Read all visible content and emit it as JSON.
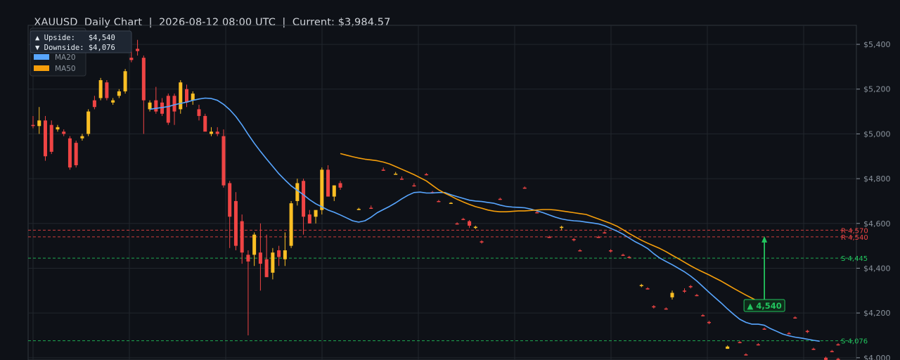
{
  "header": {
    "symbol": "XAUUSD",
    "chart_label": "Daily Chart",
    "timestamp": "2026-08-12 08:00 UTC",
    "current": "Current: $3,984.57"
  },
  "targets_box": {
    "upside": "▲ Upside:   $4,540",
    "downside": "▼ Downside: $4,076"
  },
  "legend": [
    {
      "label": "MA20",
      "color": "#58a6ff"
    },
    {
      "label": "MA50",
      "color": "#f59e0b"
    }
  ],
  "colors": {
    "background": "#0e1117",
    "grid": "#21262d",
    "up": "#fbbf24",
    "down": "#ef4444",
    "support": "#22c55e",
    "resistance": "#ef4444"
  },
  "levels": [
    {
      "label": "R 4,570",
      "value": 4570,
      "kind": "resistance"
    },
    {
      "label": "R 4,540",
      "value": 4540,
      "kind": "resistance"
    },
    {
      "label": "S 4,445",
      "value": 4445,
      "kind": "support"
    },
    {
      "label": "S 4,076",
      "value": 4076,
      "kind": "support"
    }
  ],
  "target_marker": {
    "label": "▲ 4,540",
    "value": 4540,
    "from": 4235,
    "bar": 119
  },
  "chart_data": {
    "type": "candlestick",
    "title": "XAUUSD  Daily Chart",
    "y_ticks": [
      {
        "value": 4000,
        "label": "$4,000"
      },
      {
        "value": 4200,
        "label": "$4,200"
      },
      {
        "value": 4400,
        "label": "$4,400"
      },
      {
        "value": 4600,
        "label": "$4,600"
      },
      {
        "value": 4800,
        "label": "$4,800"
      },
      {
        "value": 5000,
        "label": "$5,000"
      },
      {
        "value": 5200,
        "label": "$5,200"
      },
      {
        "value": 5400,
        "label": "$5,400"
      }
    ],
    "ylim": [
      3990,
      5485
    ],
    "x_count": 132,
    "candles": [
      [
        5040,
        5080,
        5025,
        5035
      ],
      [
        5035,
        5120,
        5000,
        5060
      ],
      [
        5060,
        5080,
        4880,
        4900
      ],
      [
        5040,
        5060,
        4910,
        4920
      ],
      [
        5020,
        5040,
        5010,
        5030
      ],
      [
        5010,
        5020,
        4990,
        5000
      ],
      [
        4980,
        4990,
        4840,
        4850
      ],
      [
        4960,
        4970,
        4850,
        4860
      ],
      [
        4980,
        5000,
        4970,
        4990
      ],
      [
        5000,
        5110,
        4990,
        5100
      ],
      [
        5150,
        5170,
        5110,
        5120
      ],
      [
        5160,
        5250,
        5150,
        5240
      ],
      [
        5230,
        5240,
        5150,
        5160
      ],
      [
        5140,
        5160,
        5130,
        5150
      ],
      [
        5170,
        5200,
        5160,
        5190
      ],
      [
        5190,
        5290,
        5180,
        5280
      ],
      [
        5340,
        5370,
        5320,
        5330
      ],
      [
        5380,
        5420,
        5350,
        5370
      ],
      [
        5340,
        5350,
        5000,
        5150
      ],
      [
        5110,
        5150,
        5100,
        5140
      ],
      [
        5150,
        5210,
        5090,
        5100
      ],
      [
        5140,
        5160,
        5080,
        5090
      ],
      [
        5170,
        5180,
        5040,
        5050
      ],
      [
        5170,
        5180,
        5040,
        5100
      ],
      [
        5110,
        5240,
        5090,
        5230
      ],
      [
        5200,
        5220,
        5120,
        5140
      ],
      [
        5150,
        5190,
        5130,
        5180
      ],
      [
        5110,
        5130,
        5060,
        5080
      ],
      [
        5080,
        5090,
        5020,
        5010
      ],
      [
        5000,
        5030,
        4990,
        5010
      ],
      [
        5010,
        5030,
        4990,
        5000
      ],
      [
        4990,
        5020,
        4760,
        4770
      ],
      [
        4780,
        4790,
        4490,
        4630
      ],
      [
        4700,
        4740,
        4480,
        4500
      ],
      [
        4610,
        4640,
        4420,
        4470
      ],
      [
        4460,
        4480,
        4100,
        4430
      ],
      [
        4460,
        4560,
        4410,
        4550
      ],
      [
        4470,
        4600,
        4300,
        4420
      ],
      [
        4440,
        4550,
        4370,
        4360
      ],
      [
        4380,
        4490,
        4350,
        4470
      ],
      [
        4480,
        4500,
        4410,
        4450
      ],
      [
        4440,
        4560,
        4410,
        4480
      ],
      [
        4500,
        4700,
        4490,
        4690
      ],
      [
        4700,
        4800,
        4680,
        4780
      ],
      [
        4790,
        4800,
        4550,
        4630
      ],
      [
        4640,
        4660,
        4600,
        4600
      ],
      [
        4630,
        4640,
        4600,
        4660
      ],
      [
        4660,
        4850,
        4640,
        4840
      ],
      [
        4840,
        4860,
        4720,
        4720
      ],
      [
        4720,
        4770,
        4700,
        4770
      ],
      [
        4780,
        4790,
        4750,
        4760
      ],
      [
        4660,
        4670,
        4660,
        4665
      ],
      [
        4670,
        4680,
        4665,
        4668
      ],
      [
        4840,
        4850,
        4835,
        4838
      ],
      [
        4820,
        4830,
        4818,
        4822
      ],
      [
        4800,
        4810,
        4795,
        4798
      ],
      [
        4770,
        4780,
        4765,
        4768
      ],
      [
        4820,
        4825,
        4815,
        4818
      ],
      [
        4740,
        4745,
        4735,
        4738
      ],
      [
        4700,
        4705,
        4695,
        4698
      ],
      [
        4690,
        4695,
        4688,
        4692
      ],
      [
        4600,
        4605,
        4595,
        4598
      ],
      [
        4620,
        4625,
        4615,
        4618
      ],
      [
        4610,
        4615,
        4580,
        4590
      ],
      [
        4580,
        4590,
        4575,
        4585
      ],
      [
        4520,
        4525,
        4510,
        4515
      ],
      [
        4710,
        4715,
        4705,
        4708
      ],
      [
        4760,
        4765,
        4755,
        4758
      ],
      [
        4650,
        4655,
        4645,
        4648
      ],
      [
        4540,
        4545,
        4535,
        4538
      ],
      [
        4580,
        4590,
        4570,
        4585
      ],
      [
        4530,
        4535,
        4520,
        4525
      ],
      [
        4480,
        4485,
        4475,
        4478
      ],
      [
        4540,
        4545,
        4535,
        4538
      ],
      [
        4560,
        4565,
        4555,
        4558
      ],
      [
        4480,
        4485,
        4470,
        4475
      ],
      [
        4460,
        4465,
        4455,
        4458
      ],
      [
        4450,
        4455,
        4445,
        4448
      ],
      [
        4320,
        4330,
        4315,
        4325
      ],
      [
        4310,
        4315,
        4305,
        4308
      ],
      [
        4230,
        4235,
        4220,
        4225
      ],
      [
        4220,
        4225,
        4215,
        4218
      ],
      [
        4270,
        4300,
        4260,
        4290
      ],
      [
        4300,
        4310,
        4290,
        4298
      ],
      [
        4320,
        4325,
        4310,
        4315
      ],
      [
        4280,
        4285,
        4275,
        4278
      ],
      [
        4190,
        4195,
        4185,
        4188
      ],
      [
        4160,
        4165,
        4150,
        4155
      ],
      [
        4040,
        4055,
        4040,
        4050
      ],
      [
        4070,
        4075,
        4065,
        4068
      ],
      [
        4015,
        4020,
        4010,
        4012
      ],
      [
        4060,
        4065,
        4055,
        4058
      ],
      [
        4130,
        4135,
        4125,
        4128
      ],
      [
        4110,
        4115,
        4105,
        4108
      ],
      [
        4180,
        4185,
        4175,
        4178
      ],
      [
        4120,
        4125,
        4110,
        4115
      ],
      [
        4040,
        4045,
        4035,
        4038
      ],
      [
        3995,
        4000,
        3990,
        3993
      ],
      [
        4030,
        4035,
        4025,
        4028
      ],
      [
        4060,
        4065,
        4055,
        4058
      ],
      [
        4000,
        4005,
        3995,
        3998
      ],
      [
        3995,
        4000,
        3990,
        3992
      ]
    ],
    "candle_bars": [
      0,
      1,
      2,
      3,
      4,
      5,
      6,
      7,
      8,
      9,
      10,
      11,
      12,
      13,
      14,
      15,
      16,
      17,
      18,
      19,
      20,
      21,
      22,
      23,
      24,
      25,
      26,
      27,
      28,
      29,
      30,
      31,
      32,
      33,
      34,
      35,
      36,
      37,
      38,
      39,
      40,
      41,
      42,
      43,
      44,
      45,
      46,
      47,
      48,
      49,
      50,
      53,
      55,
      57,
      59,
      60,
      62,
      64,
      65,
      66,
      68,
      69,
      70,
      71,
      72,
      73,
      76,
      80,
      82,
      84,
      86,
      88,
      89,
      92,
      93,
      94,
      96,
      97,
      99,
      100,
      101,
      103,
      104,
      106,
      107,
      108,
      109,
      110,
      113,
      115,
      116,
      118,
      119,
      123,
      124,
      126,
      127,
      129,
      130,
      131,
      129,
      131
    ],
    "series": [
      {
        "name": "MA20",
        "start_bar": 19,
        "values": [
          5110,
          5114,
          5118,
          5122,
          5130,
          5136,
          5142,
          5150,
          5156,
          5160,
          5158,
          5150,
          5132,
          5108,
          5078,
          5040,
          4998,
          4958,
          4922,
          4888,
          4855,
          4822,
          4794,
          4768,
          4748,
          4728,
          4706,
          4688,
          4674,
          4660,
          4650,
          4638,
          4625,
          4612,
          4606,
          4612,
          4628,
          4648,
          4662,
          4676,
          4692,
          4710,
          4726,
          4738,
          4740,
          4736,
          4736,
          4738,
          4738,
          4728,
          4720,
          4712,
          4704,
          4700,
          4698,
          4694,
          4690,
          4682,
          4676,
          4673,
          4672,
          4670,
          4664,
          4656,
          4648,
          4638,
          4628,
          4620,
          4615,
          4612,
          4610,
          4606,
          4602,
          4598,
          4590,
          4578,
          4566,
          4552,
          4535,
          4518,
          4504,
          4488,
          4465,
          4445,
          4430,
          4416,
          4400,
          4384,
          4365,
          4343,
          4318,
          4292,
          4268,
          4244,
          4218,
          4194,
          4172,
          4158,
          4150,
          4150,
          4145,
          4130,
          4118,
          4106,
          4098,
          4092,
          4088,
          4083,
          4078,
          4074
        ]
      },
      {
        "name": "MA50",
        "start_bar": 50,
        "values": [
          4912,
          4905,
          4898,
          4892,
          4887,
          4884,
          4880,
          4874,
          4866,
          4854,
          4842,
          4830,
          4818,
          4804,
          4790,
          4770,
          4750,
          4735,
          4722,
          4708,
          4696,
          4685,
          4675,
          4668,
          4660,
          4655,
          4652,
          4652,
          4654,
          4656,
          4656,
          4658,
          4660,
          4662,
          4662,
          4660,
          4656,
          4652,
          4648,
          4644,
          4640,
          4630,
          4620,
          4610,
          4600,
          4588,
          4572,
          4555,
          4540,
          4525,
          4512,
          4500,
          4488,
          4474,
          4458,
          4443,
          4427,
          4411,
          4396,
          4383,
          4370,
          4356,
          4342,
          4326,
          4310,
          4295,
          4280,
          4266,
          4252,
          4238,
          4226
        ]
      }
    ]
  }
}
